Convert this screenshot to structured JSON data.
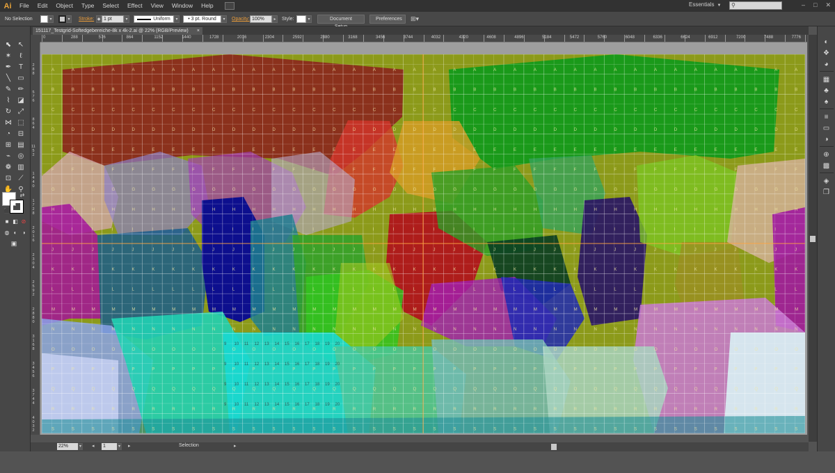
{
  "menubar": {
    "logo": "Ai",
    "items": [
      "File",
      "Edit",
      "Object",
      "Type",
      "Select",
      "Effect",
      "View",
      "Window",
      "Help"
    ],
    "workspace": "Essentials",
    "search_placeholder": ""
  },
  "control": {
    "selection_state": "No Selection",
    "stroke_label": "Stroke:",
    "stroke_weight": "1 pt",
    "profile_label": "Uniform",
    "brush_label": "3 pt. Round",
    "opacity_label": "Opacity:",
    "opacity_value": "100%",
    "style_label": "Style:",
    "doc_setup_label": "Document Setup",
    "preferences_label": "Preferences"
  },
  "document": {
    "tab_title": "151117_Testgrid-Softedgebereiche-8k x 4k-2.ai @ 22% (RGB/Preview)",
    "tab_close": "×"
  },
  "ruler_h": [
    "0",
    "288",
    "576",
    "864",
    "1152",
    "1440",
    "1728",
    "2016",
    "2304",
    "2592",
    "2880",
    "3168",
    "3456",
    "3744",
    "4032",
    "4320",
    "4608",
    "4896",
    "5184",
    "5472",
    "5760",
    "6048",
    "6336",
    "6624",
    "6912",
    "7200",
    "7488",
    "7776"
  ],
  "ruler_v": [
    "2 8 8",
    "5 7 6",
    "8 6 4",
    "1 1 5 2",
    "1 4 4 0",
    "1 7 2 8",
    "2 0 1 6",
    "2 3 0 4",
    "2 5 9 2",
    "2 8 8 0",
    "3 1 6 8",
    "3 4 5 6",
    "3 7 4 4",
    "4 0 3 2"
  ],
  "status": {
    "zoom": "22%",
    "artboard": "1",
    "tool_name": "Selection"
  },
  "testgrid": {
    "row_letters": [
      "A",
      "B",
      "C",
      "D",
      "E",
      "F",
      "G",
      "H",
      "I",
      "J",
      "K",
      "L",
      "M",
      "N",
      "O",
      "P",
      "Q",
      "R",
      "S"
    ],
    "lower_numbers": [
      "9",
      "10",
      "11",
      "12",
      "13",
      "14",
      "15",
      "16",
      "17",
      "18",
      "19",
      "20"
    ]
  }
}
